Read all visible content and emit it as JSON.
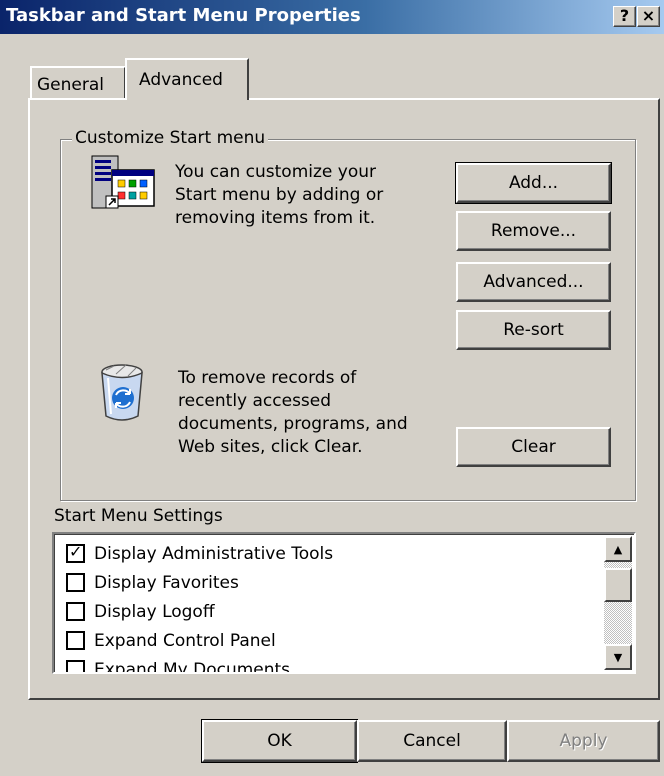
{
  "window": {
    "title": "Taskbar and Start Menu Properties",
    "help_label": "?",
    "close_label": "×"
  },
  "tabs": [
    {
      "label": "General",
      "selected": false
    },
    {
      "label": "Advanced",
      "selected": true
    }
  ],
  "customize": {
    "group_label": "Customize Start menu",
    "description_lines": [
      "You can customize your",
      "Start menu by adding or",
      "removing items from it."
    ],
    "buttons": {
      "add": "Add...",
      "remove": "Remove...",
      "advanced": "Advanced...",
      "resort": "Re-sort"
    },
    "clear_lines": [
      "To remove records of",
      "recently accessed",
      "documents, programs, and",
      "Web sites,  click Clear."
    ],
    "clear_button": "Clear",
    "icons": [
      "start-menu-icon",
      "recycle-bin-icon"
    ]
  },
  "settings": {
    "label": "Start Menu Settings",
    "items": [
      {
        "label": "Display Administrative Tools",
        "checked": true
      },
      {
        "label": "Display Favorites",
        "checked": false
      },
      {
        "label": "Display Logoff",
        "checked": false
      },
      {
        "label": "Expand Control Panel",
        "checked": false
      },
      {
        "label": "Expand My Documents",
        "checked": false
      }
    ]
  },
  "footer": {
    "ok": "OK",
    "cancel": "Cancel",
    "apply": "Apply"
  },
  "colors": {
    "face": "#d4d0c8",
    "title_start": "#0a246a",
    "title_end": "#a6caf0",
    "disabled_text": "#808080"
  }
}
